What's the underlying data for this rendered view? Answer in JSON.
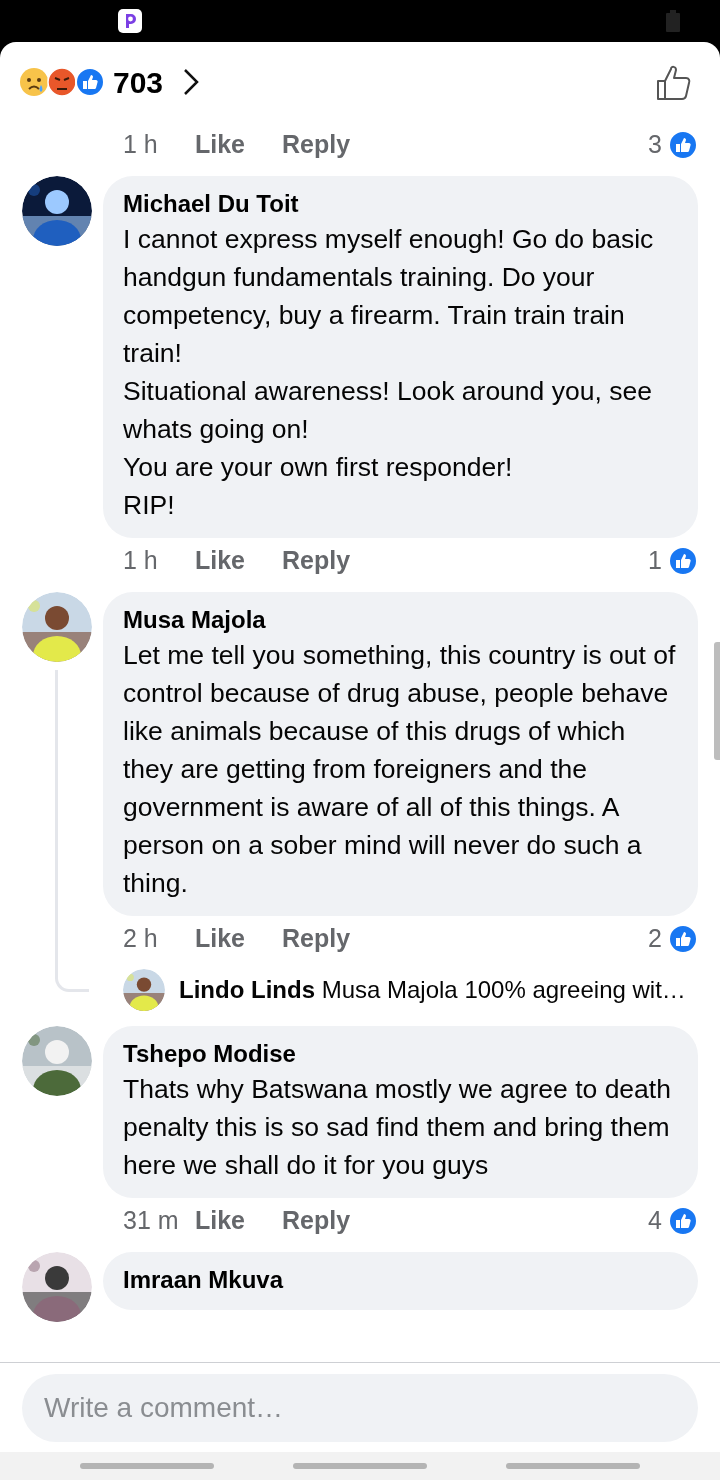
{
  "reactions": {
    "count": "703"
  },
  "top_meta": {
    "time": "1 h",
    "like": "Like",
    "reply": "Reply",
    "likes": "3"
  },
  "comments": [
    {
      "name": "Michael Du Toit",
      "text": "I cannot express myself enough! Go do basic handgun fundamentals training. Do your competency, buy a firearm. Train train train train!\nSituational awareness! Look around you, see whats going on!\nYou are your own first responder!\nRIP!",
      "time": "1 h",
      "like": "Like",
      "reply": "Reply",
      "likes": "1"
    },
    {
      "name": "Musa Majola",
      "text": "Let me tell you something, this country is out of control because of drug abuse, people behave like animals because of this drugs of which they are getting from foreigners and the government is aware of all of this things. A person on a sober mind will never do such a thing.",
      "time": "2 h",
      "like": "Like",
      "reply": "Reply",
      "likes": "2",
      "reply_preview": "**Lindo Linds** Musa Majola 100% agreeing wit…"
    },
    {
      "name": "Tshepo Modise",
      "text": "Thats why Batswana mostly we agree to death penalty this is so sad find them and bring them here we shall do it for you guys",
      "time": "31 m",
      "like": "Like",
      "reply": "Reply",
      "likes": "4"
    },
    {
      "name": "Imraan Mkuva"
    }
  ],
  "composer": {
    "placeholder": "Write a comment…"
  }
}
